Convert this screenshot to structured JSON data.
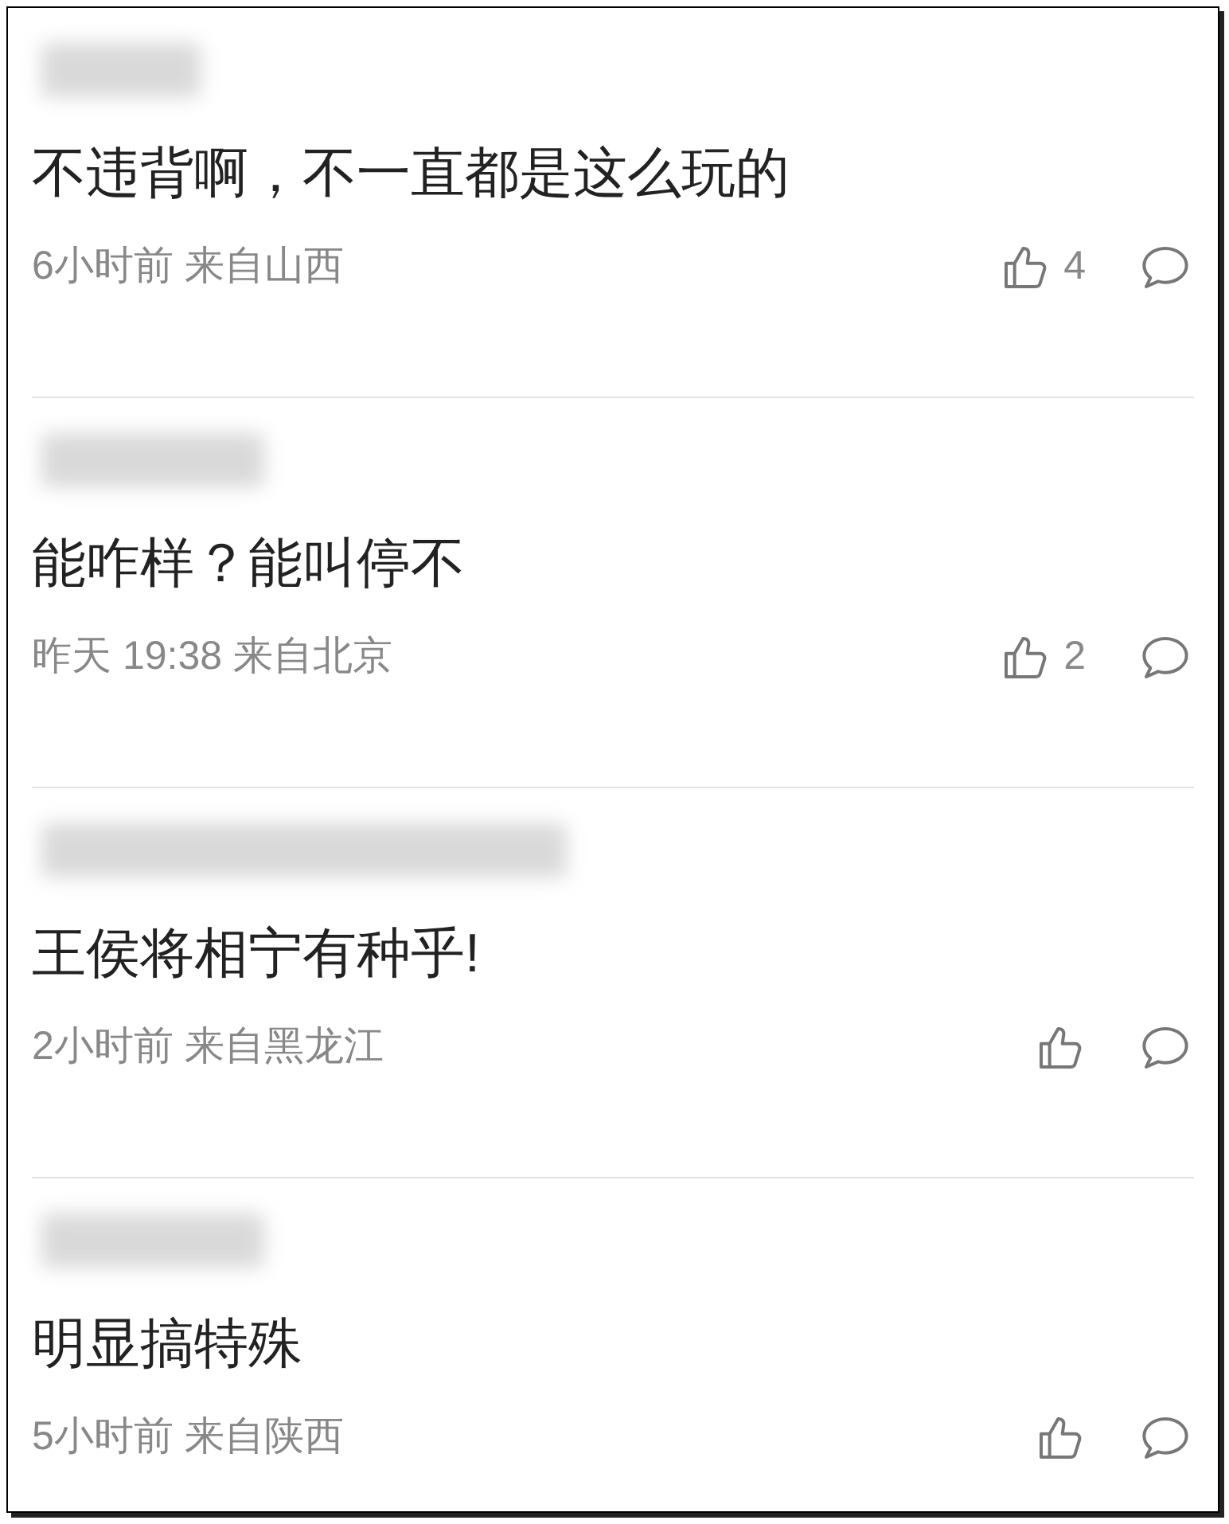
{
  "comments": [
    {
      "text": "不违背啊，不一直都是这么玩的",
      "meta": "6小时前 来自山西",
      "likes": "4"
    },
    {
      "text": "能咋样？能叫停不",
      "meta": "昨天 19:38 来自北京",
      "likes": "2"
    },
    {
      "text": "王侯将相宁有种乎!",
      "meta": "2小时前 来自黑龙江"
    },
    {
      "text": "明显搞特殊",
      "meta": "5小时前 来自陕西"
    }
  ]
}
